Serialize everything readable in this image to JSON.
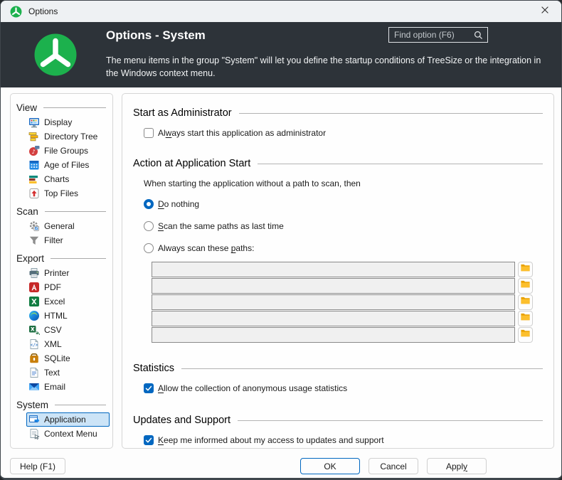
{
  "window": {
    "title": "Options"
  },
  "header": {
    "title": "Options - System",
    "description": "The menu items in the group \"System\" will let you define the startup conditions of TreeSize or the integration in the Windows context menu.",
    "search_placeholder": "Find option (F6)"
  },
  "colors": {
    "accent": "#0067c0",
    "brand_green": "#1cb14d",
    "header_bg": "#2d3339",
    "selected_item_bg": "#cce4f7",
    "folder_amber": "#fcbf2d"
  },
  "sidebar": {
    "groups": [
      {
        "label": "View",
        "items": [
          {
            "label": "Display",
            "icon": "display-icon",
            "selected": false
          },
          {
            "label": "Directory Tree",
            "icon": "directory-tree-icon",
            "selected": false
          },
          {
            "label": "File Groups",
            "icon": "file-groups-icon",
            "selected": false
          },
          {
            "label": "Age of Files",
            "icon": "age-of-files-icon",
            "selected": false
          },
          {
            "label": "Charts",
            "icon": "charts-icon",
            "selected": false
          },
          {
            "label": "Top Files",
            "icon": "top-files-icon",
            "selected": false
          }
        ]
      },
      {
        "label": "Scan",
        "items": [
          {
            "label": "General",
            "icon": "scan-general-icon",
            "selected": false
          },
          {
            "label": "Filter",
            "icon": "filter-icon",
            "selected": false
          }
        ]
      },
      {
        "label": "Export",
        "items": [
          {
            "label": "Printer",
            "icon": "printer-icon",
            "selected": false
          },
          {
            "label": "PDF",
            "icon": "pdf-icon",
            "selected": false
          },
          {
            "label": "Excel",
            "icon": "excel-icon",
            "selected": false
          },
          {
            "label": "HTML",
            "icon": "html-icon",
            "selected": false
          },
          {
            "label": "CSV",
            "icon": "csv-icon",
            "selected": false
          },
          {
            "label": "XML",
            "icon": "xml-icon",
            "selected": false
          },
          {
            "label": "SQLite",
            "icon": "sqlite-icon",
            "selected": false
          },
          {
            "label": "Text",
            "icon": "text-icon",
            "selected": false
          },
          {
            "label": "Email",
            "icon": "email-icon",
            "selected": false
          }
        ]
      },
      {
        "label": "System",
        "items": [
          {
            "label": "Application",
            "icon": "application-icon",
            "selected": true
          },
          {
            "label": "Context Menu",
            "icon": "context-menu-icon",
            "selected": false
          }
        ]
      }
    ]
  },
  "content": {
    "sections": {
      "admin": {
        "title": "Start as Administrator",
        "checkbox": {
          "checked": false,
          "pre": "Al",
          "key": "w",
          "post": "ays start this application as administrator"
        }
      },
      "action": {
        "title": "Action at Application Start",
        "intro": "When starting the application without a path to scan, then",
        "radios": [
          {
            "pre": "",
            "key": "D",
            "post": "o nothing",
            "selected": true
          },
          {
            "pre": "",
            "key": "S",
            "post": "can the same paths as last time",
            "selected": false
          },
          {
            "pre": "Always scan these ",
            "key": "p",
            "post": "aths:",
            "selected": false
          }
        ],
        "paths": [
          "",
          "",
          "",
          "",
          ""
        ]
      },
      "statistics": {
        "title": "Statistics",
        "checkbox": {
          "checked": true,
          "pre": "",
          "key": "A",
          "post": "llow the collection of anonymous usage statistics"
        }
      },
      "updates": {
        "title": "Updates and Support",
        "checkbox": {
          "checked": true,
          "pre": "",
          "key": "K",
          "post": "eep me informed about my access to updates and support"
        }
      }
    }
  },
  "footer": {
    "help_label": "Help (F1)",
    "ok_label": "OK",
    "cancel_label": "Cancel",
    "apply": {
      "pre": "Appl",
      "key": "y",
      "post": ""
    }
  }
}
